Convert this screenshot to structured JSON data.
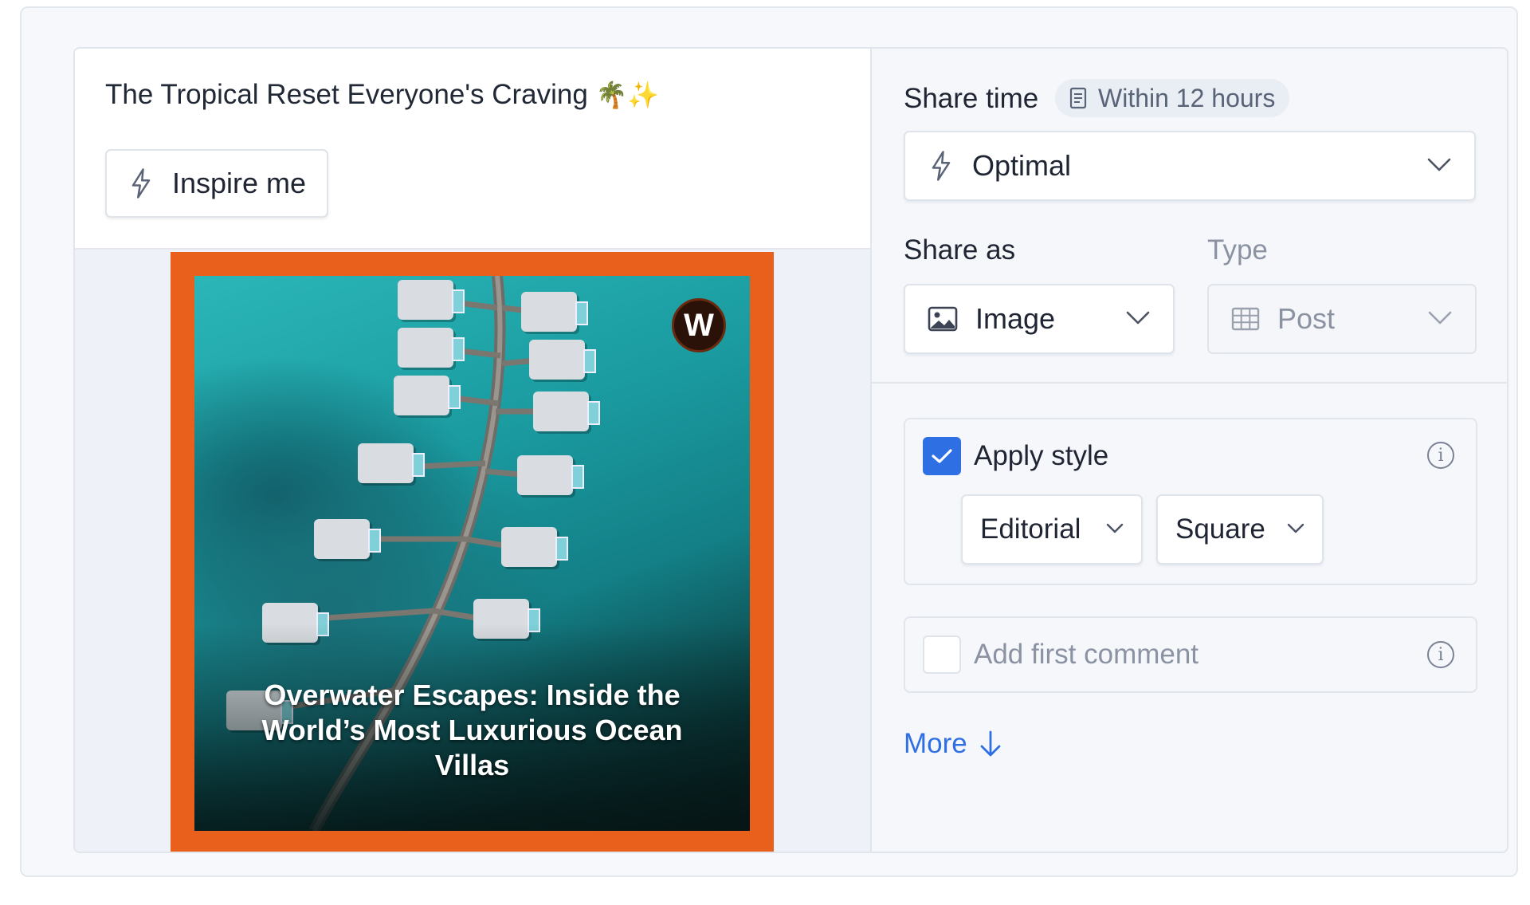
{
  "post": {
    "title": "The Tropical Reset Everyone's Craving",
    "title_emoji": "🌴✨",
    "inspire_label": "Inspire me",
    "media_caption": "Overwater Escapes: Inside the World’s Most Luxurious Ocean Villas",
    "media_logo_letter": "W",
    "media_frame_color": "#e8601c"
  },
  "share_time": {
    "label": "Share time",
    "badge": "Within 12 hours",
    "selected": "Optimal"
  },
  "share_as": {
    "label": "Share as",
    "selected": "Image"
  },
  "type": {
    "label": "Type",
    "selected": "Post",
    "disabled": true
  },
  "apply_style": {
    "label": "Apply style",
    "checked": true,
    "style_option": "Editorial",
    "format_option": "Square"
  },
  "first_comment": {
    "label": "Add first comment",
    "checked": false
  },
  "more_label": "More",
  "colors": {
    "accent": "#2f6fe4",
    "muted_text": "#8b93a3"
  },
  "icons": {
    "inspire": "bolt-icon",
    "share_time": "bolt-icon",
    "badge": "document-icon",
    "share_as": "image-icon",
    "type": "grid-icon",
    "info": "info-icon",
    "more": "arrow-down-icon"
  }
}
